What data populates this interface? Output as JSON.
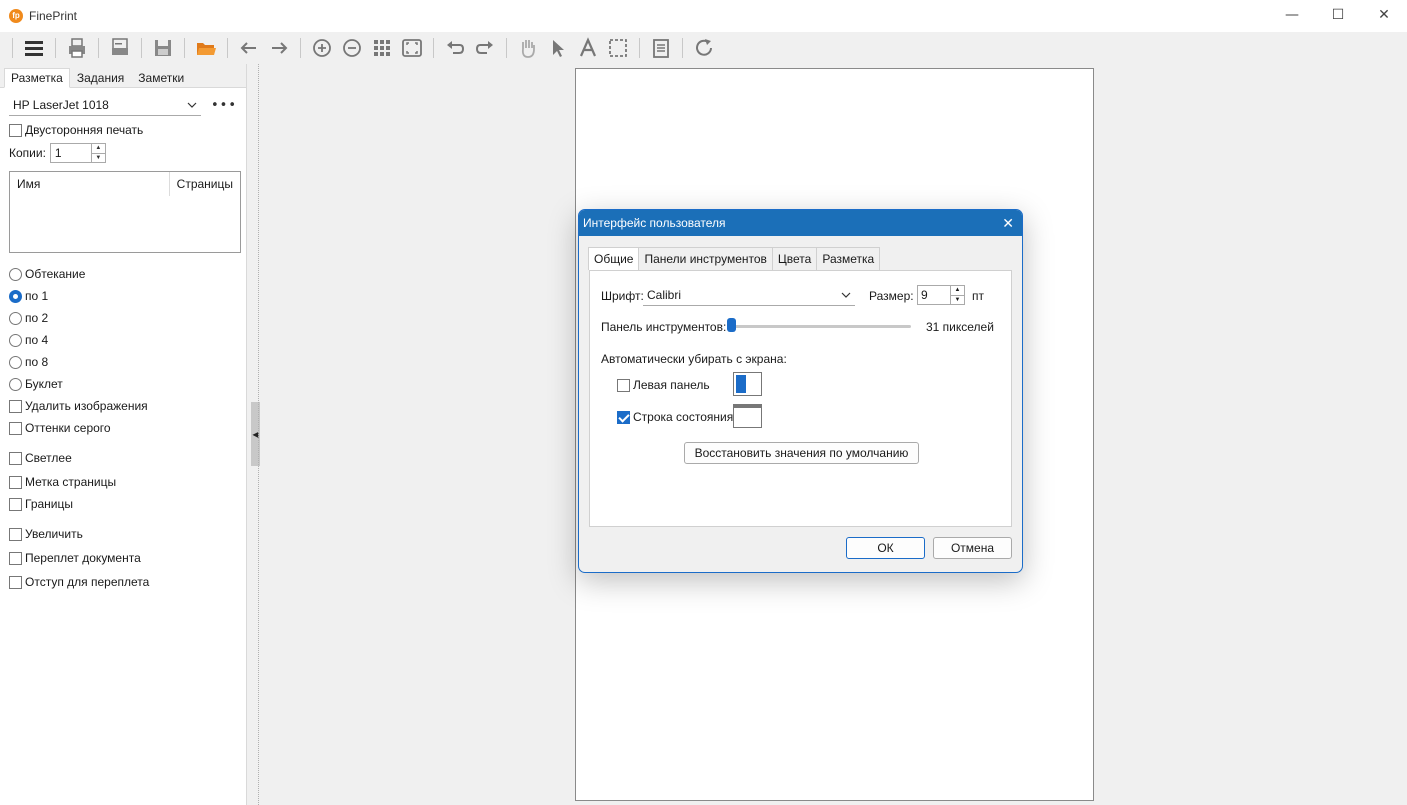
{
  "app": {
    "title": "FinePrint"
  },
  "window_controls": {
    "minimize": "—",
    "maximize": "☐",
    "close": "✕"
  },
  "left_panel": {
    "tabs": [
      "Разметка",
      "Задания",
      "Заметки"
    ],
    "printer": "HP LaserJet 1018",
    "more": "•••",
    "duplex": "Двусторонняя печать",
    "copies_label": "Копии:",
    "copies_value": "1",
    "table_headers": [
      "Имя",
      "Страницы"
    ],
    "layout_options": [
      {
        "label": "Обтекание",
        "checked": false
      },
      {
        "label": "по 1",
        "checked": true
      },
      {
        "label": "по 2",
        "checked": false
      },
      {
        "label": "по 4",
        "checked": false
      },
      {
        "label": "по 8",
        "checked": false
      },
      {
        "label": "Буклет",
        "checked": false
      }
    ],
    "checkboxes_a": [
      "Удалить изображения",
      "Оттенки серого"
    ],
    "checkboxes_b": [
      "Светлее",
      "Метка страницы",
      "Границы"
    ],
    "checkboxes_c": [
      "Увеличить",
      "Переплет документа",
      "Отступ для переплета"
    ]
  },
  "dialog": {
    "title": "Интерфейс пользователя",
    "tabs": [
      "Общие",
      "Панели инструментов",
      "Цвета",
      "Разметка"
    ],
    "font_label": "Шрифт:",
    "font_value": "Calibri",
    "size_label": "Размер:",
    "size_value": "9",
    "size_unit": "пт",
    "toolbar_label": "Панель инструментов:",
    "toolbar_value": "31 пикселей",
    "auto_hide_label": "Автоматически убирать с экрана:",
    "left_panel_label": "Левая панель",
    "left_panel_checked": false,
    "status_bar_label": "Строка состояния",
    "status_bar_checked": true,
    "restore_button": "Восстановить значения по умолчанию",
    "ok_button": "ОК",
    "cancel_button": "Отмена"
  }
}
